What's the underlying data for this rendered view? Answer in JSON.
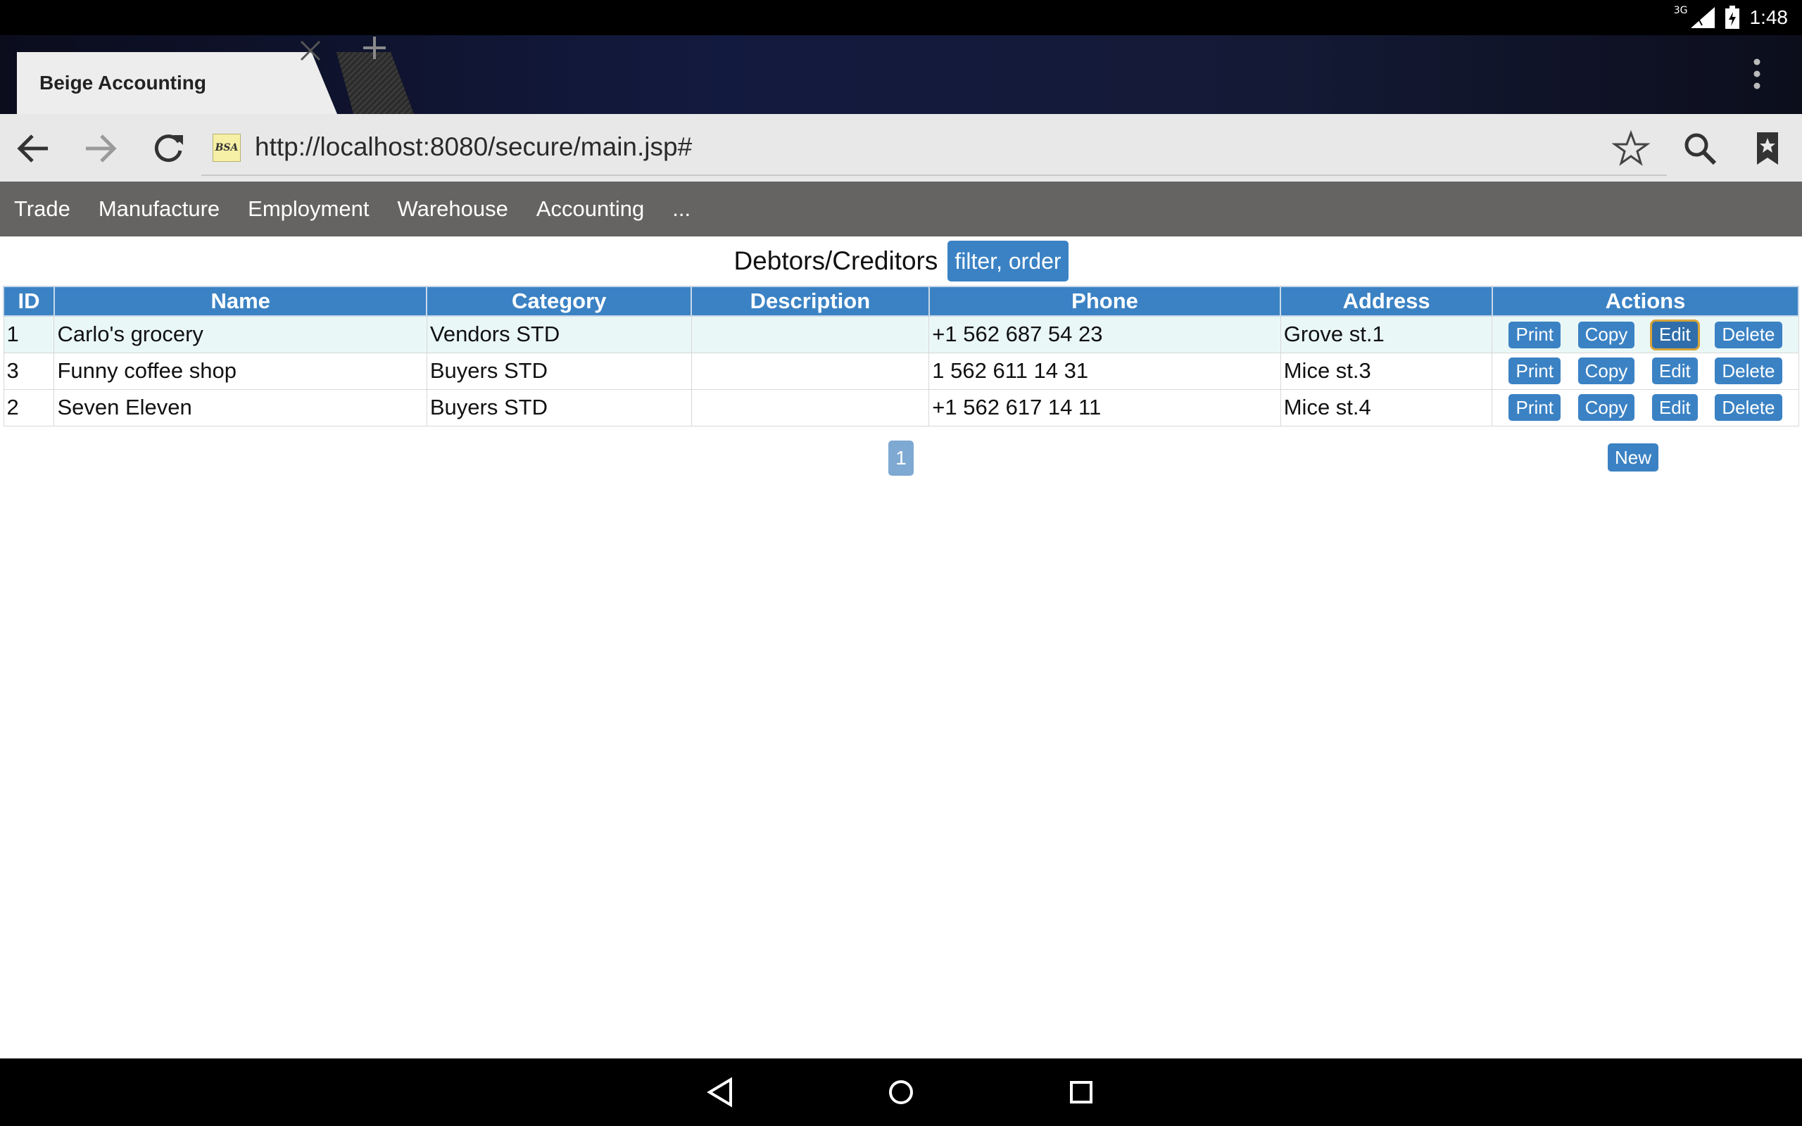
{
  "status_bar": {
    "time": "1:48",
    "network": "3G"
  },
  "browser": {
    "tab_title": "Beige Accounting",
    "favicon_text": "BSA",
    "url": "http://localhost:8080/secure/main.jsp#"
  },
  "site_menu": {
    "items": [
      "Trade",
      "Manufacture",
      "Employment",
      "Warehouse",
      "Accounting",
      "..."
    ]
  },
  "page": {
    "title": "Debtors/Creditors",
    "filter_label": "filter, order"
  },
  "table": {
    "columns": [
      "ID",
      "Name",
      "Category",
      "Description",
      "Phone",
      "Address",
      "Actions"
    ],
    "action_labels": {
      "print": "Print",
      "copy": "Copy",
      "edit": "Edit",
      "delete": "Delete"
    },
    "rows": [
      {
        "id": "1",
        "name": "Carlo's grocery",
        "category": "Vendors STD",
        "description": "",
        "phone": "+1 562 687 54 23",
        "address": "Grove st.1"
      },
      {
        "id": "3",
        "name": "Funny coffee shop",
        "category": "Buyers STD",
        "description": "",
        "phone": "1 562 611 14 31",
        "address": "Mice st.3"
      },
      {
        "id": "2",
        "name": "Seven Eleven",
        "category": "Buyers STD",
        "description": "",
        "phone": "+1 562 617 14 11",
        "address": "Mice st.4"
      }
    ]
  },
  "pagination": {
    "current_page": "1"
  },
  "new_label": "New",
  "colors": {
    "accent": "#3b82c4",
    "menu_bar": "#666462",
    "row_highlight": "#eaf7f7"
  }
}
